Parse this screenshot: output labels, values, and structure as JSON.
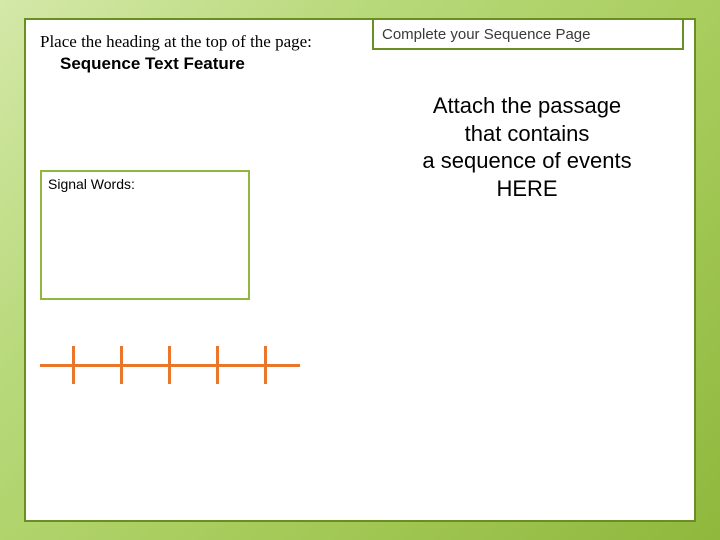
{
  "left": {
    "instruction": "Place the heading at the top of the page:",
    "heading": "Sequence Text Feature",
    "signal_label": "Signal Words:"
  },
  "right": {
    "title": "Complete your Sequence Page",
    "attach_line1": "Attach the passage",
    "attach_line2": "that contains",
    "attach_line3": "a sequence of events",
    "attach_line4": "HERE"
  },
  "colors": {
    "accent_green": "#8fb83d",
    "accent_orange": "#e9762b"
  }
}
